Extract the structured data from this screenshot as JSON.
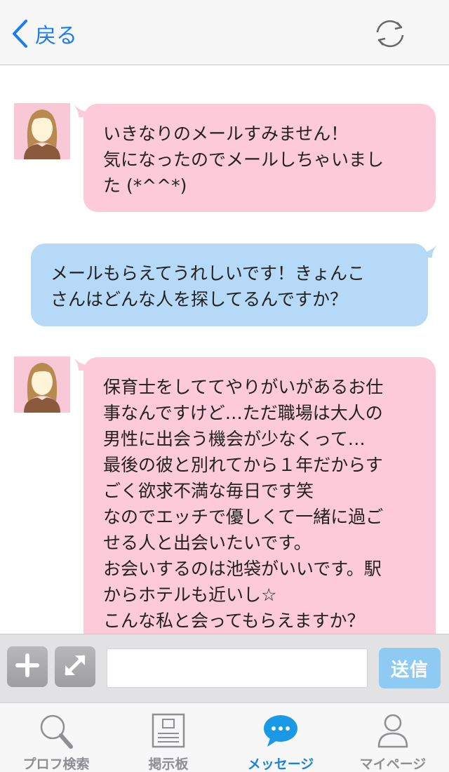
{
  "header": {
    "back_label": "戻る",
    "back_icon": "chevron-left-icon",
    "refresh_icon": "refresh-icon"
  },
  "messages": [
    {
      "direction": "incoming",
      "avatar": "female-avatar",
      "text": "いきなりのメールすみません！\n気になったのでメールしちゃいまし\nた (*^^*)"
    },
    {
      "direction": "outgoing",
      "text": "メールもらえてうれしいです！きょんこ\nさんはどんな人を探してるんですか？"
    },
    {
      "direction": "incoming",
      "avatar": "female-avatar",
      "text": "保育士をしててやりがいがあるお仕\n事なんですけど…ただ職場は大人の\n男性に出会う機会が少なくって…\n最後の彼と別れてから１年だからす\nごく欲求不満な毎日です笑\nなのでエッチで優しくて一緒に過ご\nせる人と出会いたいです。\nお会いするのは池袋がいいです。駅\nからホテルも近いし☆\nこんな私と会ってもらえますか？"
    }
  ],
  "input_bar": {
    "add_icon": "plus-icon",
    "expand_icon": "expand-icon",
    "input_value": "",
    "send_label": "送信"
  },
  "tabbar": {
    "tabs": [
      {
        "label": "プロフ検索",
        "icon": "search-icon",
        "active": false
      },
      {
        "label": "掲示板",
        "icon": "board-icon",
        "active": false
      },
      {
        "label": "メッセージ",
        "icon": "chat-bubble-icon",
        "active": true
      },
      {
        "label": "マイページ",
        "icon": "person-icon",
        "active": false
      }
    ]
  },
  "colors": {
    "accent": "#1a82e0",
    "incoming_bubble": "#fccad9",
    "outgoing_bubble": "#b5d9f6",
    "send_button": "#8fcaf2"
  }
}
